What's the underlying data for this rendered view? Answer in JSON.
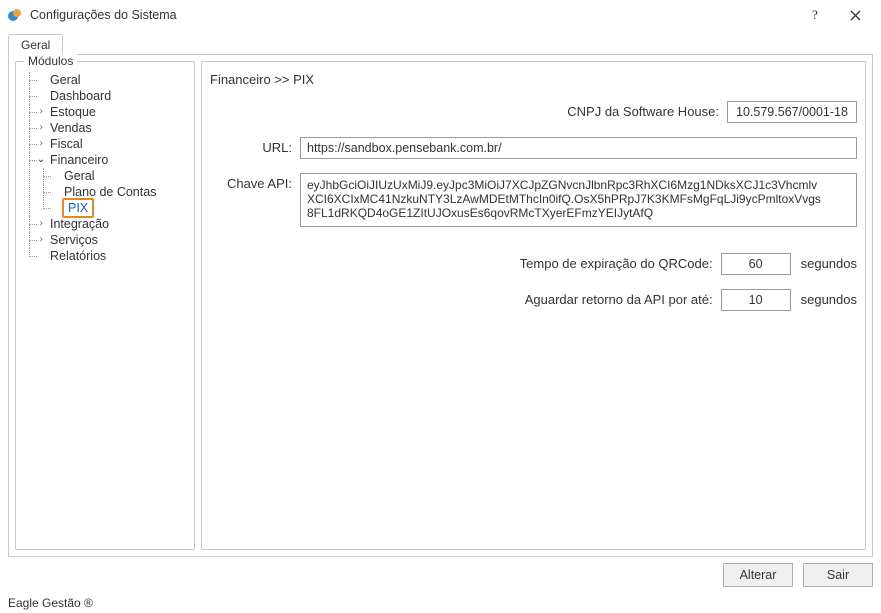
{
  "window": {
    "title": "Configurações do Sistema"
  },
  "tabs": {
    "geral": "Geral"
  },
  "sidebar": {
    "legend": "Módulos",
    "items": {
      "geral": "Geral",
      "dashboard": "Dashboard",
      "estoque": "Estoque",
      "vendas": "Vendas",
      "fiscal": "Fiscal",
      "financeiro": "Financeiro",
      "fin_geral": "Geral",
      "fin_plano": "Plano de Contas",
      "fin_pix": "PIX",
      "integracao": "Integração",
      "servicos": "Serviços",
      "relatorios": "Relatórios"
    }
  },
  "main": {
    "breadcrumb": "Financeiro >> PIX",
    "fields": {
      "cnpj_label": "CNPJ da Software House:",
      "cnpj_value": "10.579.567/0001-18",
      "url_label": "URL:",
      "url_value": "https://sandbox.pensebank.com.br/",
      "api_label": "Chave API:",
      "api_value": "eyJhbGciOiJIUzUxMiJ9.eyJpc3MiOiJ7XCJpZGNvcnJlbnRpc3RhXCI6Mzg1NDksXCJ1c3Vhcmlv\nXCI6XCIxMC41NzkuNTY3LzAwMDEtMThcIn0ifQ.OsX5hPRpJ7K3KMFsMgFqLJi9ycPmltoxVvgs\n8FL1dRKQD4oGE1ZItUJOxusEs6qovRMcTXyerEFmzYEIJytAfQ",
      "qrcode_label": "Tempo de expiração do QRCode:",
      "qrcode_value": "60",
      "api_wait_label": "Aguardar retorno da API por até:",
      "api_wait_value": "10",
      "suffix_seconds": "segundos"
    }
  },
  "buttons": {
    "alterar": "Alterar",
    "sair": "Sair"
  },
  "statusbar": {
    "text": "Eagle Gestão ®"
  }
}
